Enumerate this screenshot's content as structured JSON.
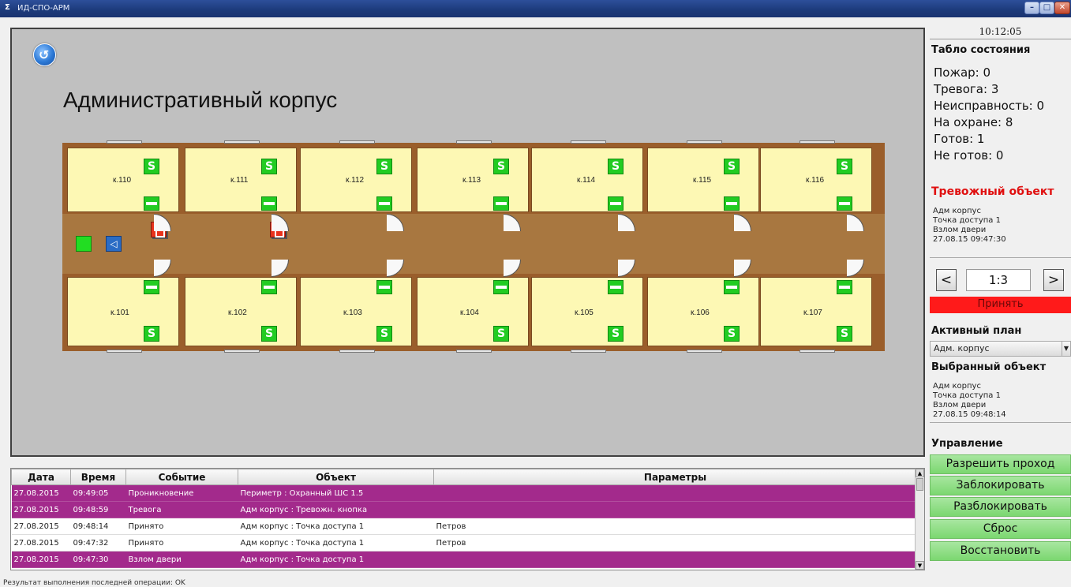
{
  "window": {
    "app_icon": "Σ",
    "title": "ИД-СПО-АРМ",
    "min": "–",
    "max": "□",
    "close": "✕"
  },
  "plan": {
    "back_icon": "↺",
    "title": "Административный корпус",
    "top_rooms": [
      "к.110",
      "к.111",
      "к.112",
      "к.113",
      "к.114",
      "к.115",
      "к.116"
    ],
    "bottom_rooms": [
      "к.101",
      "к.102",
      "к.103",
      "к.104",
      "к.105",
      "к.106",
      "к.107"
    ],
    "sensor_glyph": "S",
    "speaker_glyph": "◁"
  },
  "clock": "10:12:05",
  "status_board": {
    "title": "Табло состояния",
    "items": [
      "Пожар: 0",
      "Тревога: 3",
      "Неисправность: 0",
      "На охране: 8",
      "Готов: 1",
      "Не готов: 0"
    ]
  },
  "alarm_object": {
    "title": "Тревожный объект",
    "lines": [
      "Адм корпус",
      "Точка доступа 1",
      "Взлом двери",
      "27.08.15 09:47:30"
    ]
  },
  "navigator": {
    "prev": "<",
    "counter": "1:3",
    "next": ">",
    "accept": "Принять"
  },
  "active_plan": {
    "title": "Активный план",
    "selected": "Адм. корпус",
    "arrow": "▼"
  },
  "selected_object": {
    "title": "Выбранный объект",
    "lines": [
      "Адм корпус",
      "Точка доступа 1",
      "Взлом двери",
      "27.08.15 09:48:14"
    ]
  },
  "control": {
    "title": "Управление",
    "buttons": [
      "Разрешить проход",
      "Заблокировать",
      "Разблокировать",
      "Сброс",
      "Восстановить"
    ]
  },
  "log": {
    "columns": [
      "Дата",
      "Время",
      "Событие",
      "Объект",
      "Параметры"
    ],
    "rows": [
      {
        "date": "27.08.2015",
        "time": "09:49:05",
        "event": "Проникновение",
        "object": "Периметр : Охранный ШС 1.5",
        "params": "",
        "alarm": true
      },
      {
        "date": "27.08.2015",
        "time": "09:48:59",
        "event": "Тревога",
        "object": "Адм корпус : Тревожн. кнопка",
        "params": "",
        "alarm": true
      },
      {
        "date": "27.08.2015",
        "time": "09:48:14",
        "event": "Принято",
        "object": "Адм корпус : Точка доступа 1",
        "params": "Петров",
        "alarm": false
      },
      {
        "date": "27.08.2015",
        "time": "09:47:32",
        "event": "Принято",
        "object": "Адм корпус : Точка доступа 1",
        "params": "Петров",
        "alarm": false
      },
      {
        "date": "27.08.2015",
        "time": "09:47:30",
        "event": "Взлом двери",
        "object": "Адм корпус : Точка доступа 1",
        "params": "",
        "alarm": true
      }
    ],
    "scroll_up": "▲",
    "scroll_down": "▼"
  },
  "status_bar": "Результат выполнения последней операции: OK"
}
